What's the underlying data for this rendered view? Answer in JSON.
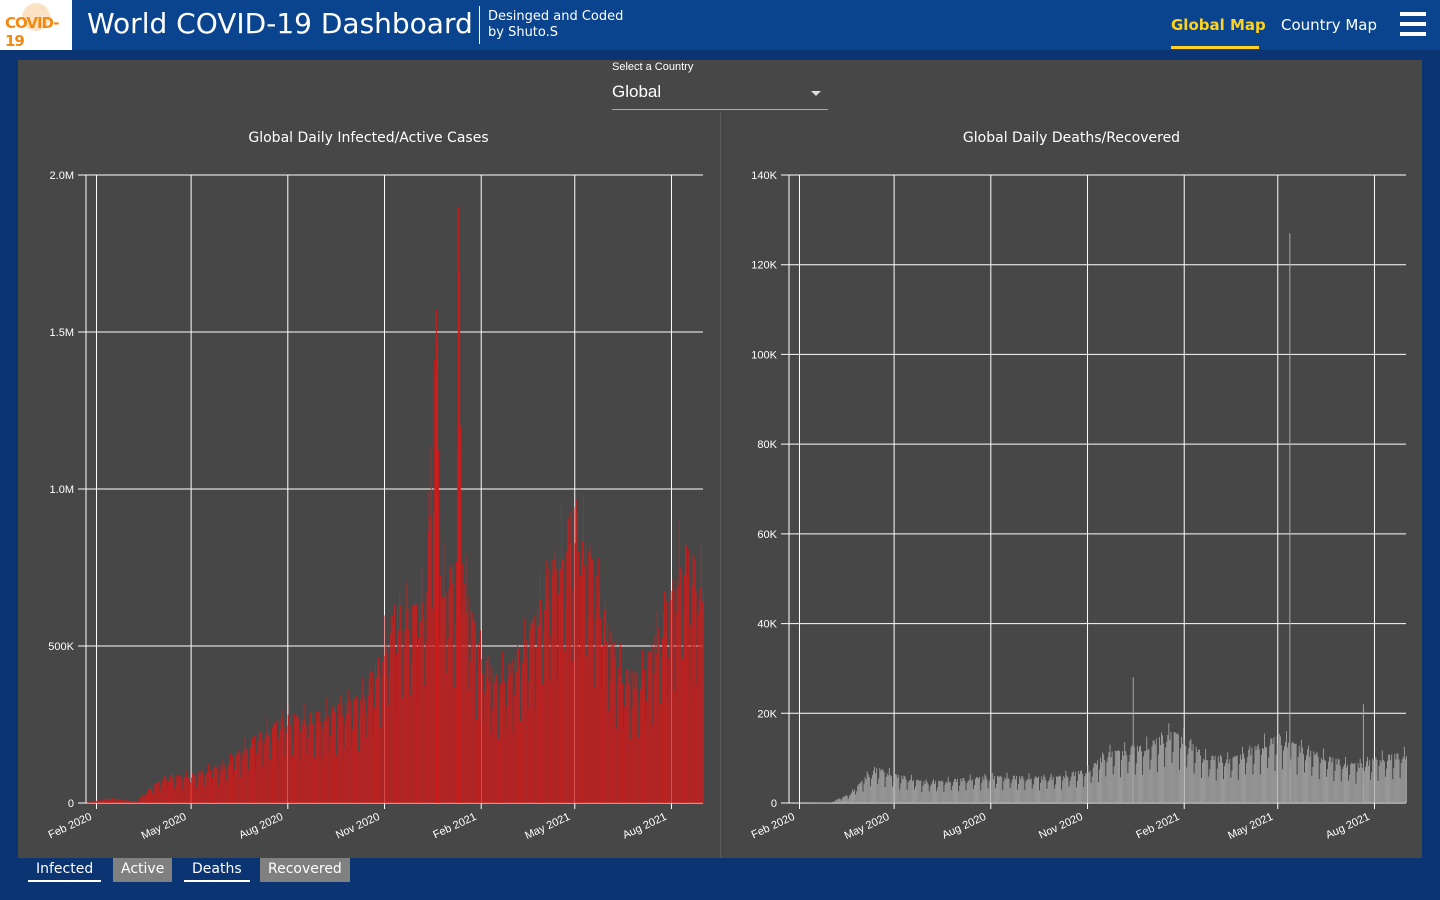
{
  "header": {
    "logo_text": "COVID-19",
    "title": "World COVID-19 Dashboard",
    "credit_line1": "Desinged and Coded",
    "credit_line2": "by Shuto.S",
    "nav": {
      "global_map": "Global Map",
      "country_map": "Country Map"
    },
    "colors": {
      "bar": "#0a448e",
      "active_link": "#ffd21f",
      "logo": "#f08a14"
    }
  },
  "selector": {
    "label": "Select a Country",
    "value": "Global"
  },
  "toggles": [
    {
      "label": "Infected",
      "active": true
    },
    {
      "label": "Active",
      "active": false
    },
    {
      "label": "Deaths",
      "active": true
    },
    {
      "label": "Recovered",
      "active": false
    }
  ],
  "chart_data": [
    {
      "type": "bar",
      "title": "Global Daily Infected/Active Cases",
      "x_ticks": [
        "Feb 2020",
        "May 2020",
        "Aug 2020",
        "Nov 2020",
        "Feb 2021",
        "May 2021",
        "Aug 2021"
      ],
      "y_ticks": [
        "0",
        "500K",
        "1.0M",
        "1.5M",
        "2.0M"
      ],
      "ylim": [
        0,
        2000000
      ],
      "xlim": [
        "2020-01-22",
        "2021-08-31"
      ],
      "grid": true,
      "series": [
        {
          "color": "#d01b1b",
          "points": [
            [
              "2020-01-22",
              600
            ],
            [
              "2020-02-13",
              15000
            ],
            [
              "2020-03-10",
              5000
            ],
            [
              "2020-03-25",
              55000
            ],
            [
              "2020-04-10",
              85000
            ],
            [
              "2020-05-01",
              85000
            ],
            [
              "2020-06-01",
              120000
            ],
            [
              "2020-07-01",
              200000
            ],
            [
              "2020-07-15",
              235000
            ],
            [
              "2020-08-01",
              270000
            ],
            [
              "2020-08-15",
              265000
            ],
            [
              "2020-09-01",
              270000
            ],
            [
              "2020-09-20",
              300000
            ],
            [
              "2020-10-10",
              330000
            ],
            [
              "2020-10-25",
              420000
            ],
            [
              "2020-11-10",
              590000
            ],
            [
              "2020-11-25",
              600000
            ],
            [
              "2020-12-10",
              640000
            ],
            [
              "2020-12-20",
              1480000
            ],
            [
              "2020-12-25",
              680000
            ],
            [
              "2021-01-08",
              720000
            ],
            [
              "2021-01-10",
              1690000
            ],
            [
              "2021-01-15",
              700000
            ],
            [
              "2021-02-01",
              450000
            ],
            [
              "2021-02-15",
              380000
            ],
            [
              "2021-03-01",
              420000
            ],
            [
              "2021-03-15",
              500000
            ],
            [
              "2021-04-01",
              660000
            ],
            [
              "2021-04-25",
              850000
            ],
            [
              "2021-05-01",
              880000
            ],
            [
              "2021-05-15",
              780000
            ],
            [
              "2021-06-01",
              540000
            ],
            [
              "2021-06-15",
              400000
            ],
            [
              "2021-07-01",
              380000
            ],
            [
              "2021-07-15",
              500000
            ],
            [
              "2021-08-01",
              650000
            ],
            [
              "2021-08-10",
              780000
            ],
            [
              "2021-08-31",
              680000
            ]
          ]
        }
      ]
    },
    {
      "type": "bar",
      "title": "Global Daily Deaths/Recovered",
      "x_ticks": [
        "Feb 2020",
        "May 2020",
        "Aug 2020",
        "Nov 2020",
        "Feb 2021",
        "May 2021",
        "Aug 2021"
      ],
      "y_ticks": [
        "0",
        "20K",
        "40K",
        "60K",
        "80K",
        "100K",
        "120K",
        "140K"
      ],
      "ylim": [
        0,
        140000
      ],
      "xlim": [
        "2020-01-22",
        "2021-08-31"
      ],
      "grid": true,
      "series": [
        {
          "color": "#a8a8a8",
          "points": [
            [
              "2020-01-22",
              20
            ],
            [
              "2020-03-01",
              100
            ],
            [
              "2020-03-20",
              2000
            ],
            [
              "2020-04-05",
              6000
            ],
            [
              "2020-04-15",
              7500
            ],
            [
              "2020-05-01",
              6000
            ],
            [
              "2020-06-01",
              4500
            ],
            [
              "2020-07-01",
              5000
            ],
            [
              "2020-08-01",
              5800
            ],
            [
              "2020-09-01",
              5500
            ],
            [
              "2020-10-01",
              5600
            ],
            [
              "2020-11-01",
              7000
            ],
            [
              "2020-11-20",
              11000
            ],
            [
              "2020-12-10",
              11500
            ],
            [
              "2020-12-25",
              12000
            ],
            [
              "2021-01-10",
              14000
            ],
            [
              "2021-01-20",
              15500
            ],
            [
              "2021-02-01",
              14000
            ],
            [
              "2021-02-20",
              10000
            ],
            [
              "2021-03-15",
              9500
            ],
            [
              "2021-04-01",
              11000
            ],
            [
              "2021-04-20",
              13000
            ],
            [
              "2021-05-01",
              14000
            ],
            [
              "2021-05-15",
              13000
            ],
            [
              "2021-06-01",
              11000
            ],
            [
              "2021-06-20",
              9500
            ],
            [
              "2021-07-05",
              8500
            ],
            [
              "2021-07-20",
              8500
            ],
            [
              "2021-08-01",
              9500
            ],
            [
              "2021-08-31",
              10500
            ]
          ],
          "spikes": [
            [
              "2020-12-14",
              28000
            ],
            [
              "2021-05-12",
              127000
            ],
            [
              "2021-07-21",
              22000
            ]
          ]
        }
      ]
    }
  ]
}
